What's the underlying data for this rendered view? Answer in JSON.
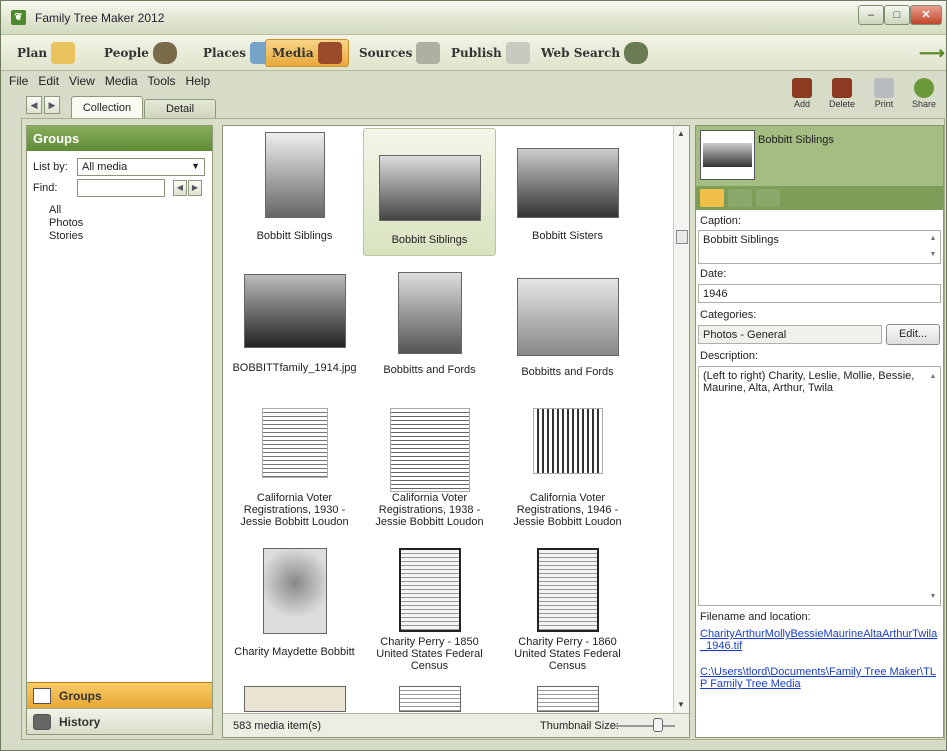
{
  "window": {
    "title": "Family Tree Maker 2012"
  },
  "nav": {
    "items": [
      {
        "label": "Plan",
        "icon": "plan-icon",
        "color": "#e8c25a"
      },
      {
        "label": "People",
        "icon": "people-icon",
        "color": "#7a6a4a"
      },
      {
        "label": "Places",
        "icon": "places-icon",
        "color": "#78a3c9"
      },
      {
        "label": "Media",
        "icon": "media-icon",
        "color": "#9b4a2a"
      },
      {
        "label": "Sources",
        "icon": "sources-icon",
        "color": "#b0b0a0"
      },
      {
        "label": "Publish",
        "icon": "publish-icon",
        "color": "#c9c9c0"
      },
      {
        "label": "Web Search",
        "icon": "web-search-icon",
        "color": "#6a7a52"
      }
    ],
    "active": "Media"
  },
  "menu": [
    "File",
    "Edit",
    "View",
    "Media",
    "Tools",
    "Help"
  ],
  "tabs": {
    "collection": "Collection",
    "detail": "Detail"
  },
  "toolbar": {
    "add": "Add",
    "delete": "Delete",
    "print": "Print",
    "share": "Share"
  },
  "groups": {
    "header": "Groups",
    "list_by_label": "List by:",
    "list_by_value": "All media",
    "find_label": "Find:",
    "items": [
      "All",
      "Photos",
      "Stories"
    ],
    "bottom_groups": "Groups",
    "bottom_history": "History"
  },
  "gallery": {
    "items": [
      "Bobbitt Siblings",
      "Bobbitt Siblings",
      "Bobbitt Sisters",
      "BOBBITTfamily_1914.jpg",
      "Bobbitts and Fords",
      "Bobbitts and Fords",
      "California Voter Registrations, 1930 - Jessie Bobbitt Loudon",
      "California Voter Registrations, 1938 - Jessie Bobbitt Loudon",
      "California Voter Registrations, 1946 - Jessie Bobbitt Loudon",
      "Charity Maydette Bobbitt",
      "Charity Perry - 1850 United States Federal Census",
      "Charity Perry - 1860 United States Federal Census"
    ],
    "count": "583 media item(s)",
    "thumb_size_label": "Thumbnail Size:"
  },
  "detail": {
    "title": "Bobbitt Siblings",
    "caption_label": "Caption:",
    "caption": "Bobbitt Siblings",
    "date_label": "Date:",
    "date": "1946",
    "categories_label": "Categories:",
    "categories": "Photos - General",
    "edit_button": "Edit...",
    "description_label": "Description:",
    "description": "(Left to right) Charity, Leslie, Mollie, Bessie, Maurine, Alta, Arthur, Twila",
    "filename_label": "Filename and location:",
    "filename": "CharityArthurMollyBessieMaurineAltaArthurTwila_1946.tif",
    "location": "C:\\Users\\tlord\\Documents\\Family Tree Maker\\TLP Family Tree Media"
  }
}
